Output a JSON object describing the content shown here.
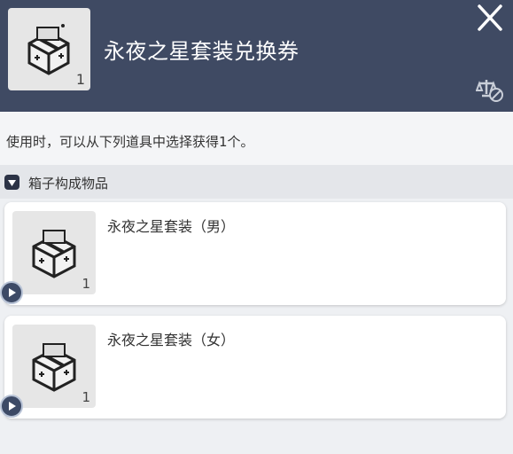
{
  "header": {
    "title": "永夜之星套装兑换券",
    "item_count": "1",
    "icons": {
      "item": "gift-box-icon",
      "close": "close-icon",
      "trade": "trade-restricted-icon"
    }
  },
  "description": "使用时，可以从下列道具中选择获得1个。",
  "section": {
    "label": "箱子构成物品",
    "icon": "box-icon"
  },
  "items": [
    {
      "name": "永夜之星套装（男）",
      "count": "1",
      "icon": "gift-box-icon"
    },
    {
      "name": "永夜之星套装（女）",
      "count": "1",
      "icon": "gift-box-icon"
    }
  ],
  "colors": {
    "header_bg": "#3f4a63",
    "page_bg": "#eef0f3",
    "card_bg": "#ffffff",
    "accent": "#3d4a66"
  }
}
